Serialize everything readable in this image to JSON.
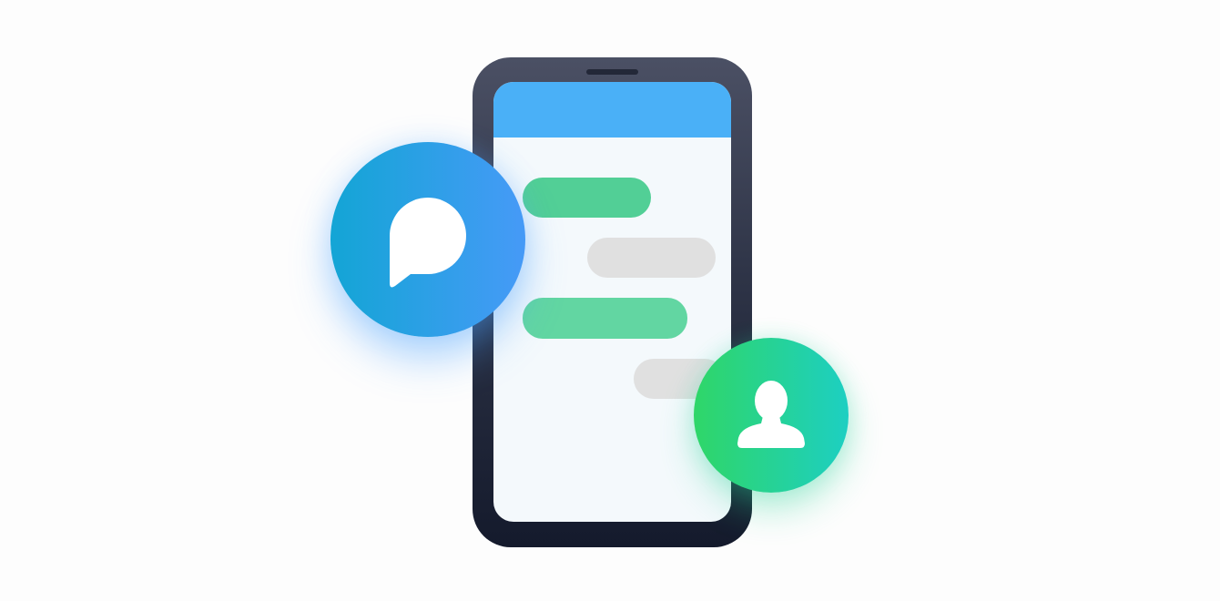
{
  "scene": {
    "background": "#fdfdfd"
  },
  "phone": {
    "body_gradient": [
      "#4b5064",
      "#141a2c"
    ],
    "screen_color": "#f4f9fc",
    "header_color": "#4ab0f7",
    "messages": [
      {
        "side": "left",
        "color": "#52cf96"
      },
      {
        "side": "right",
        "color": "#e0e0e0"
      },
      {
        "side": "left",
        "color": "#62d6a2"
      },
      {
        "side": "right",
        "color": "#e0e0e0"
      }
    ]
  },
  "badges": {
    "chat": {
      "icon": "chat-bubble-icon",
      "gradient": [
        "#13a5d5",
        "#469af7"
      ]
    },
    "contact": {
      "icon": "person-icon",
      "gradient": [
        "#2fd668",
        "#1dcfc2"
      ]
    }
  }
}
